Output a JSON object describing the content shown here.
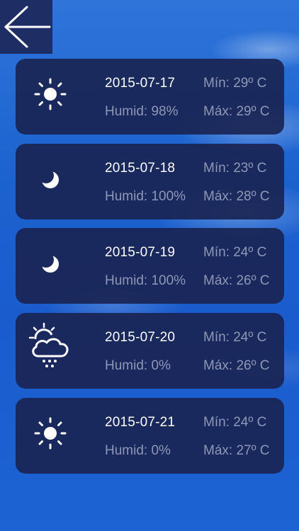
{
  "back_button": {
    "icon": "arrow-left-icon"
  },
  "forecast": [
    {
      "icon": "sun-icon",
      "date": "2015-07-17",
      "min": "Mín: 29º C",
      "humid": "Humid: 98%",
      "max": "Máx: 29º C"
    },
    {
      "icon": "moon-icon",
      "date": "2015-07-18",
      "min": "Mín: 23º C",
      "humid": "Humid: 100%",
      "max": "Máx: 28º C"
    },
    {
      "icon": "moon-icon",
      "date": "2015-07-19",
      "min": "Mín: 24º C",
      "humid": "Humid: 100%",
      "max": "Máx: 26º C"
    },
    {
      "icon": "sun-cloud-rain-icon",
      "date": "2015-07-20",
      "min": "Mín: 24º C",
      "humid": "Humid: 0%",
      "max": "Máx: 26º C"
    },
    {
      "icon": "sun-icon",
      "date": "2015-07-21",
      "min": "Mín: 24º C",
      "humid": "Humid: 0%",
      "max": "Máx: 27º C"
    }
  ],
  "colors": {
    "card_bg": "#1a2554",
    "back_bg": "#1e2d63",
    "primary_text": "#ffffff",
    "secondary_text": "#8e97b6",
    "sky": "#1c62cf"
  }
}
